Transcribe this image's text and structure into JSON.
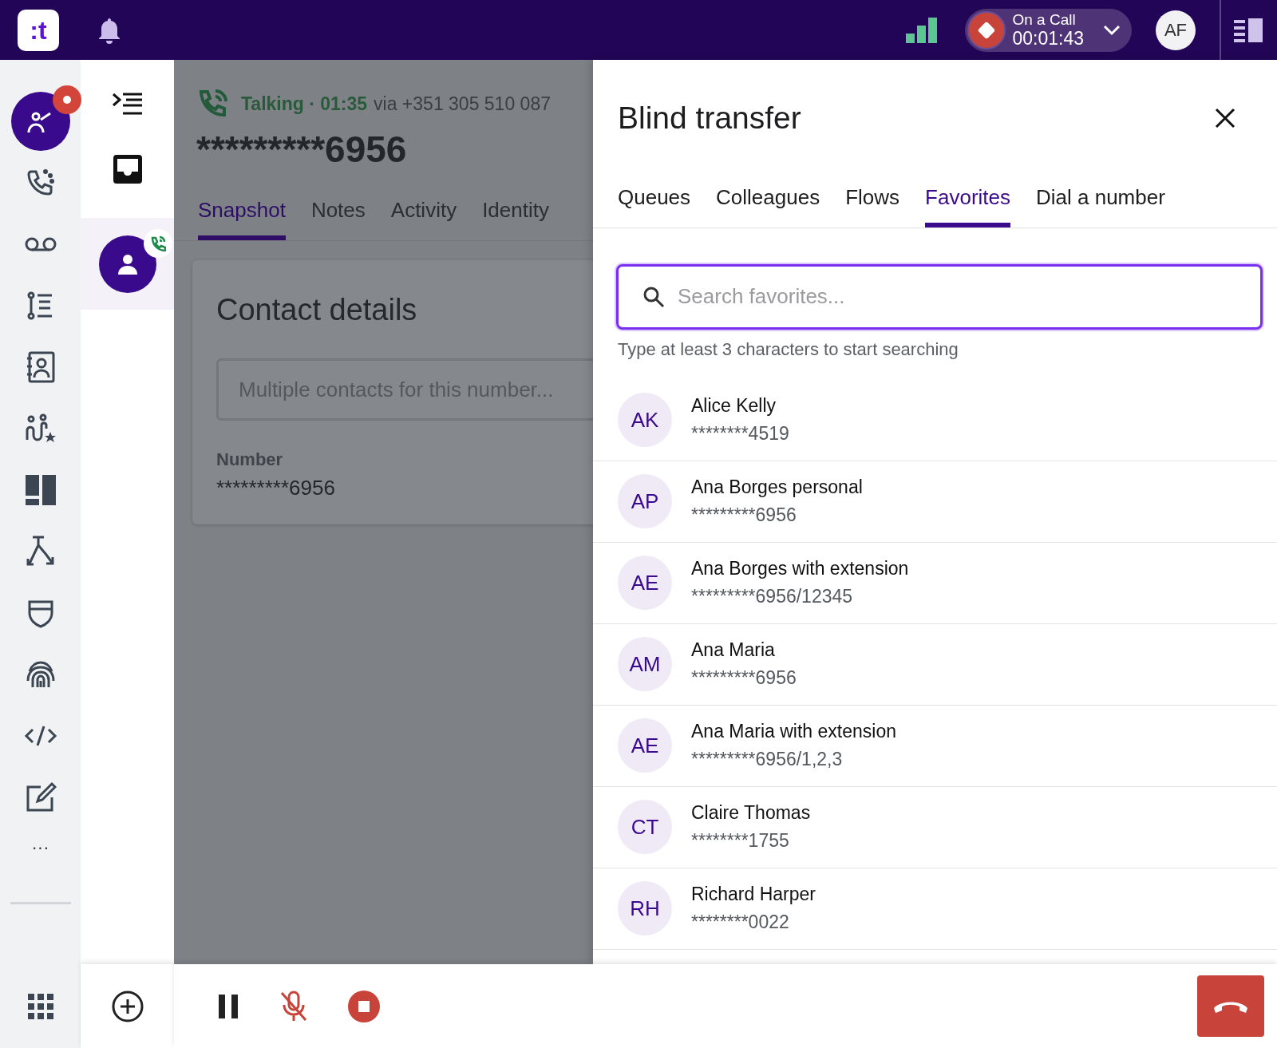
{
  "topbar": {
    "logo": ":t",
    "call_status": {
      "label": "On a Call",
      "timer": "00:01:43"
    },
    "user_initials": "AF"
  },
  "rail": {
    "items": [
      {
        "kind": "agent",
        "selected": true,
        "notification": true
      },
      {
        "kind": "phone",
        "selected": false,
        "notification": false
      },
      {
        "kind": "voicemail",
        "selected": false,
        "notification": false
      },
      {
        "kind": "timeline",
        "selected": false,
        "notification": false
      },
      {
        "kind": "contacts",
        "selected": false,
        "notification": false
      },
      {
        "kind": "team",
        "selected": false,
        "notification": false
      },
      {
        "kind": "dashboard",
        "selected": false,
        "notification": false
      },
      {
        "kind": "flows",
        "selected": false,
        "notification": false
      },
      {
        "kind": "shield",
        "selected": false,
        "notification": false
      },
      {
        "kind": "fingerprint",
        "selected": false,
        "notification": false
      },
      {
        "kind": "code",
        "selected": false,
        "notification": false
      },
      {
        "kind": "edit",
        "selected": false,
        "notification": false
      }
    ],
    "more": "···"
  },
  "call": {
    "status": "Talking · 01:35",
    "via": "via +351 305 510 087",
    "number": "*********6956",
    "tabs": [
      {
        "label": "Snapshot",
        "selected": true
      },
      {
        "label": "Notes",
        "selected": false
      },
      {
        "label": "Activity",
        "selected": false
      },
      {
        "label": "Identity",
        "selected": false
      }
    ],
    "card": {
      "title": "Contact details",
      "select_placeholder": "Multiple contacts for this number...",
      "field_label": "Number",
      "field_value": "*********6956"
    }
  },
  "transfer": {
    "title": "Blind transfer",
    "tabs": [
      {
        "label": "Queues",
        "selected": false
      },
      {
        "label": "Colleagues",
        "selected": false
      },
      {
        "label": "Flows",
        "selected": false
      },
      {
        "label": "Favorites",
        "selected": true
      },
      {
        "label": "Dial a number",
        "selected": false
      }
    ],
    "search": {
      "placeholder": "Search favorites..."
    },
    "hint": "Type at least 3 characters to start searching",
    "contacts": [
      {
        "initials": "AK",
        "name": "Alice Kelly",
        "number": "********4519"
      },
      {
        "initials": "AP",
        "name": "Ana Borges personal",
        "number": "*********6956"
      },
      {
        "initials": "AE",
        "name": "Ana Borges with extension",
        "number": "*********6956/12345"
      },
      {
        "initials": "AM",
        "name": "Ana Maria",
        "number": "*********6956"
      },
      {
        "initials": "AE",
        "name": "Ana Maria with extension",
        "number": "*********6956/1,2,3"
      },
      {
        "initials": "CT",
        "name": "Claire Thomas",
        "number": "********1755"
      },
      {
        "initials": "RH",
        "name": "Richard Harper",
        "number": "********0022"
      }
    ]
  }
}
